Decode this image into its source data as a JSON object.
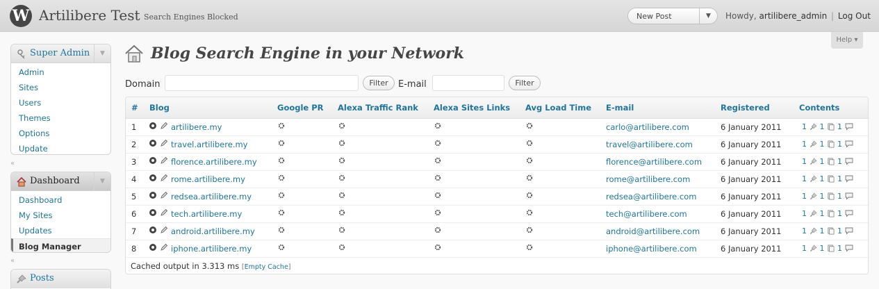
{
  "header": {
    "site_title": "Artilibere Test",
    "site_visibility": "Search Engines Blocked",
    "favorite_action": "New Post",
    "howdy": "Howdy,",
    "username": "artilibere_admin",
    "separator": "|",
    "logout": "Log Out"
  },
  "help": {
    "label": "Help"
  },
  "menu": {
    "super_admin": {
      "title": "Super Admin",
      "items": [
        "Admin",
        "Sites",
        "Users",
        "Themes",
        "Options",
        "Update"
      ]
    },
    "dashboard": {
      "title": "Dashboard",
      "items": [
        "Dashboard",
        "My Sites",
        "Updates",
        "Blog Manager"
      ],
      "current": "Blog Manager"
    },
    "posts": {
      "title": "Posts"
    }
  },
  "page": {
    "title": "Blog Search Engine in your Network",
    "domain_label": "Domain",
    "domain_value": "",
    "filter_button": "Filter",
    "email_label": "E-mail",
    "email_value": ""
  },
  "table": {
    "columns": [
      "#",
      "Blog",
      "Google PR",
      "Alexa Traffic Rank",
      "Alexa Sites Links",
      "Avg Load Time",
      "E-mail",
      "Registered",
      "Contents"
    ],
    "rows": [
      {
        "num": "1",
        "blog": "artilibere.my",
        "email": "carlo@artilibere.com",
        "registered": "6 January 2011",
        "posts": "1",
        "pages": "1",
        "comments": "1"
      },
      {
        "num": "2",
        "blog": "travel.artilibere.my",
        "email": "travel@artilibere.com",
        "registered": "6 January 2011",
        "posts": "1",
        "pages": "1",
        "comments": "1"
      },
      {
        "num": "3",
        "blog": "florence.artilibere.my",
        "email": "florence@artilibere.com",
        "registered": "6 January 2011",
        "posts": "1",
        "pages": "1",
        "comments": "1"
      },
      {
        "num": "4",
        "blog": "rome.artilibere.my",
        "email": "rome@artilibere.com",
        "registered": "6 January 2011",
        "posts": "1",
        "pages": "1",
        "comments": "1"
      },
      {
        "num": "5",
        "blog": "redsea.artilibere.my",
        "email": "redsea@artilibere.com",
        "registered": "6 January 2011",
        "posts": "1",
        "pages": "1",
        "comments": "1"
      },
      {
        "num": "6",
        "blog": "tech.artilibere.my",
        "email": "tech@artilibere.com",
        "registered": "6 January 2011",
        "posts": "1",
        "pages": "1",
        "comments": "1"
      },
      {
        "num": "7",
        "blog": "android.artilibere.my",
        "email": "android@artilibere.com",
        "registered": "6 January 2011",
        "posts": "1",
        "pages": "1",
        "comments": "1"
      },
      {
        "num": "8",
        "blog": "iphone.artilibere.my",
        "email": "iphone@artilibere.com",
        "registered": "6 January 2011",
        "posts": "1",
        "pages": "1",
        "comments": "1"
      }
    ],
    "footer_text": "Cached output in 3.313 ms",
    "empty_cache": "Empty Cache"
  },
  "colors": {
    "link": "#21759b",
    "header_bg": "#d9d9d9",
    "text": "#333333"
  },
  "icons": [
    "wordpress-logo-icon",
    "user-key-icon",
    "house-icon",
    "pushpin-icon",
    "view-icon",
    "edit-icon",
    "loading-gear-icon",
    "page-icon",
    "comment-icon"
  ]
}
